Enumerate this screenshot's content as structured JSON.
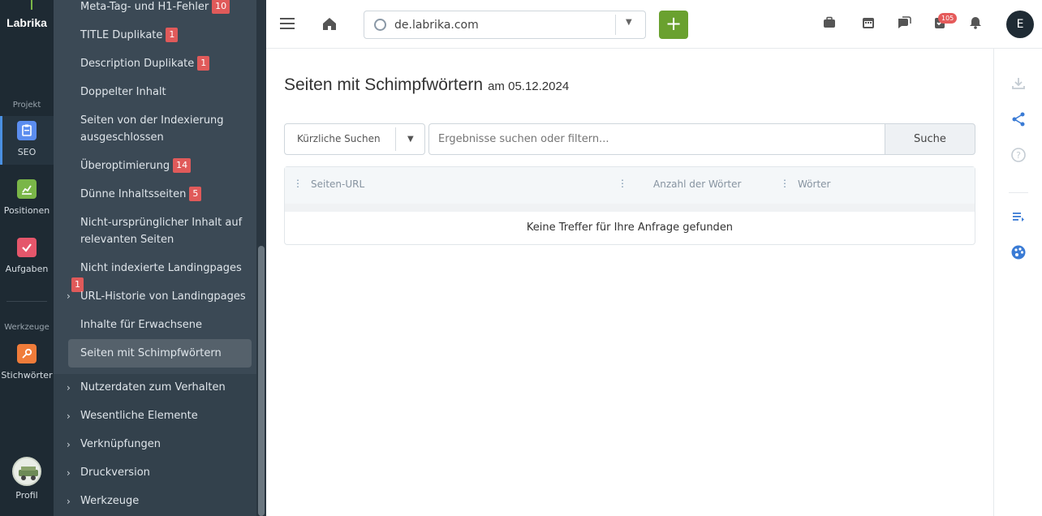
{
  "rail": {
    "logo": "Labrika",
    "section_project": "Projekt",
    "section_tools": "Werkzeuge",
    "items": [
      {
        "label": "SEO",
        "icon": "clipboard-icon",
        "color": "#5b8def"
      },
      {
        "label": "Positionen",
        "icon": "chart-icon",
        "color": "#7ab648"
      },
      {
        "label": "Aufgaben",
        "icon": "check-icon",
        "color": "#e5566b"
      },
      {
        "label": "Stichwörter",
        "icon": "key-icon",
        "color": "#f07c3a"
      }
    ],
    "profile_label": "Profil"
  },
  "subnav": {
    "items": [
      {
        "label": "Meta-Tag- und H1-Fehler",
        "badge": "10"
      },
      {
        "label": "TITLE Duplikate",
        "badge": "1"
      },
      {
        "label": "Description Duplikate",
        "badge": "1"
      },
      {
        "label": "Doppelter Inhalt"
      },
      {
        "label": "Seiten von der Indexierung",
        "label2": "ausgeschlossen"
      },
      {
        "label": "Überoptimierung",
        "badge": "14"
      },
      {
        "label": "Dünne Inhaltsseiten",
        "badge": "5"
      },
      {
        "label": "Nicht-ursprünglicher Inhalt auf",
        "label2": "relevanten Seiten"
      },
      {
        "label": "Nicht indexierte Landingpages",
        "badge": "1"
      },
      {
        "label": "URL-Historie von Landingpages"
      },
      {
        "label": "Inhalte für Erwachsene"
      },
      {
        "label": "Seiten mit Schimpfwörtern"
      }
    ],
    "groups": [
      {
        "label": "Nutzerdaten zum Verhalten"
      },
      {
        "label": "Wesentliche Elemente"
      },
      {
        "label": "Verknüpfungen"
      },
      {
        "label": "Druckversion"
      },
      {
        "label": "Werkzeuge"
      }
    ]
  },
  "topbar": {
    "domain": "de.labrika.com",
    "add_label": "+",
    "task_count": "105",
    "user_initial": "E"
  },
  "page": {
    "title": "Seiten mit Schimpfwörtern",
    "date": "am 05.12.2024"
  },
  "filter": {
    "recent_label": "Kürzliche Suchen",
    "search_placeholder": "Ergebnisse suchen oder filtern...",
    "search_button": "Suche"
  },
  "table": {
    "columns": [
      "Seiten-URL",
      "Anzahl der Wörter",
      "Wörter"
    ],
    "empty_message": "Keine Treffer für Ihre Anfrage gefunden"
  }
}
